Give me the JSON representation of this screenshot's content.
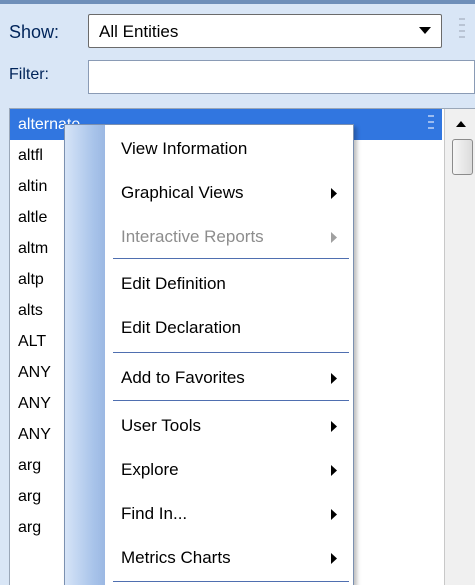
{
  "toolbar": {
    "show_label": "Show:",
    "show_value": "All Entities",
    "filter_label": "Filter:",
    "filter_value": ""
  },
  "entity_list": {
    "items": [
      {
        "label": "alternate",
        "selected": true
      },
      {
        "label": "altfl"
      },
      {
        "label": "altin"
      },
      {
        "label": "altle"
      },
      {
        "label": "altm"
      },
      {
        "label": "altp"
      },
      {
        "label": "alts"
      },
      {
        "label": "ALT"
      },
      {
        "label": "ANY"
      },
      {
        "label": "ANY"
      },
      {
        "label": "ANY"
      },
      {
        "label": "arg"
      },
      {
        "label": "arg"
      },
      {
        "label": "arg"
      }
    ]
  },
  "context_menu": {
    "items": [
      {
        "label": "View Information",
        "submenu": false,
        "enabled": true
      },
      {
        "label": "Graphical Views",
        "submenu": true,
        "enabled": true
      },
      {
        "label": "Interactive Reports",
        "submenu": true,
        "enabled": false
      },
      {
        "label": "Edit Definition",
        "submenu": false,
        "enabled": true
      },
      {
        "label": "Edit Declaration",
        "submenu": false,
        "enabled": true
      },
      {
        "label": "Add to Favorites",
        "submenu": true,
        "enabled": true
      },
      {
        "label": "User Tools",
        "submenu": true,
        "enabled": true
      },
      {
        "label": "Explore",
        "submenu": true,
        "enabled": true
      },
      {
        "label": "Find In...",
        "submenu": true,
        "enabled": true
      },
      {
        "label": "Metrics Charts",
        "submenu": true,
        "enabled": true
      }
    ]
  },
  "colors": {
    "selection": "#3176e0",
    "menu_separator": "#4f6fb0",
    "disabled_text": "#8d8d8d"
  },
  "icons": [
    "dropdown-arrow-icon",
    "grip-icon",
    "submenu-arrow-icon",
    "scroll-up-arrow-icon"
  ]
}
